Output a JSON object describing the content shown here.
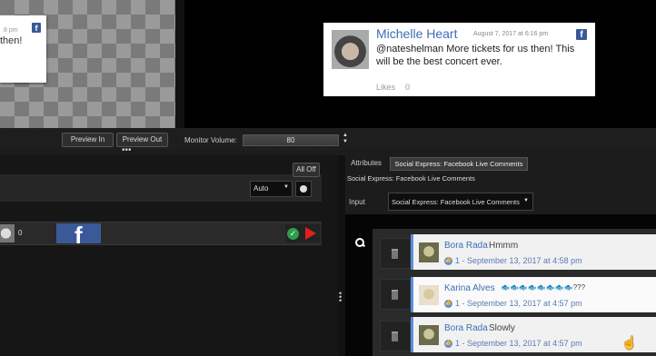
{
  "preview": {
    "left_post": {
      "time_fragment": "8 pm",
      "text_fragment": "then!"
    },
    "right_post": {
      "name": "Michelle Heart",
      "date": "August 7, 2017 at 6:16 pm",
      "text": "@nateshelman More tickets for us then! This will be the best concert ever.",
      "likes_label": "Likes",
      "likes_count": "0"
    },
    "preview_in_label": "Preview In",
    "preview_out_label": "Preview Out",
    "monitor_volume_label": "Monitor Volume:",
    "monitor_volume_value": "80"
  },
  "layers": {
    "all_off_label": "All Off",
    "mode_select_value": "Auto",
    "row_count": "0"
  },
  "attributes_panel": {
    "tabs": [
      {
        "label": "Attributes"
      },
      {
        "label": "Social Express: Facebook Live Comments"
      }
    ],
    "header": "Social Express: Facebook Live Comments",
    "input_label": "Input",
    "input_value": "Social Express: Facebook Live Comments"
  },
  "comments": [
    {
      "name": "Bora Rada",
      "text": "Hmmm",
      "meta": "1 - September 13, 2017 at 4:58 pm"
    },
    {
      "name": "Karina Alves",
      "text": "🐟🐟🐟🐟🐟🐟🐟🐟???",
      "meta": "1 - September 13, 2017 at 4:57 pm"
    },
    {
      "name": "Bora Rada",
      "text": "Slowly",
      "meta": "1 - September 13, 2017 at 4:57 pm"
    }
  ],
  "colors": {
    "facebook_blue": "#3b5998",
    "name_blue": "#3b6fb5",
    "accent_green": "#2e9e4a",
    "accent_red": "#e0201a"
  }
}
